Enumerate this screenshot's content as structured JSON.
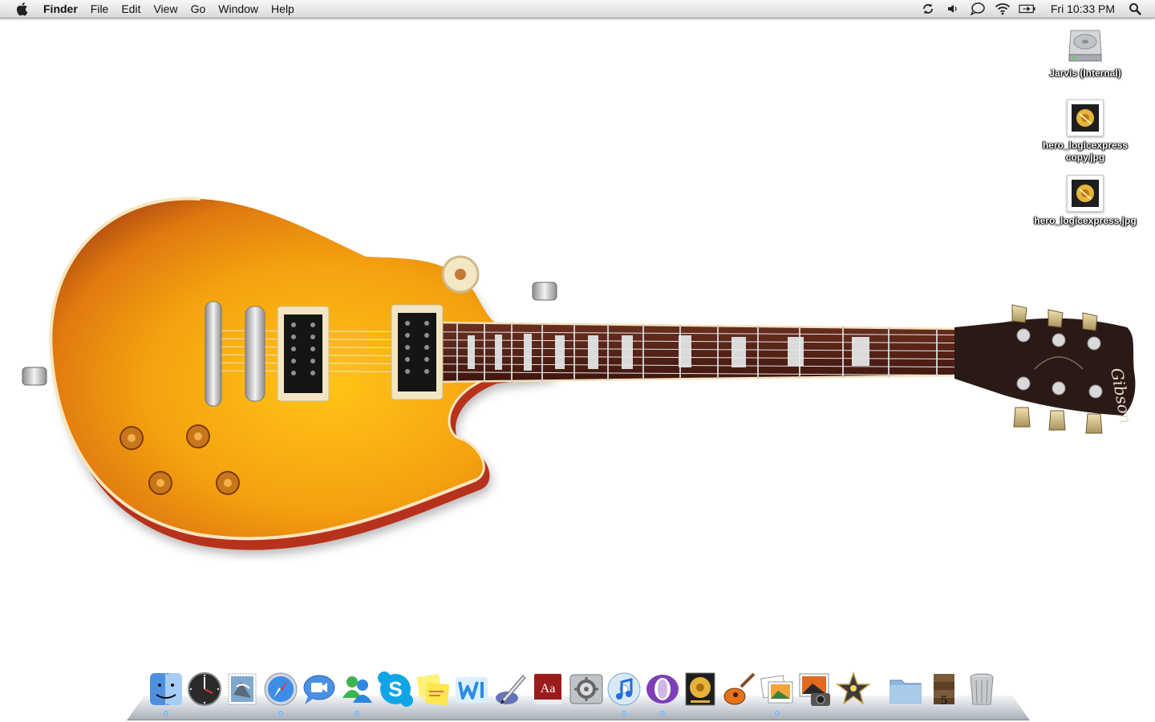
{
  "menubar": {
    "apple_icon": "apple-logo-icon",
    "app_name": "Finder",
    "menus": [
      "File",
      "Edit",
      "View",
      "Go",
      "Window",
      "Help"
    ],
    "status_icons": [
      "sync-icon",
      "volume-icon",
      "ichat-icon",
      "wifi-icon",
      "battery-icon"
    ],
    "clock": "Fri 10:33 PM",
    "spotlight_icon": "spotlight-search-icon"
  },
  "desktop": {
    "icons": [
      {
        "label": "Jarvis (Internal)",
        "icon": "hard-drive-icon"
      },
      {
        "label": "hero_logicexpress copy.jpg",
        "icon": "image-file-icon"
      },
      {
        "label": "hero_logicexpress.jpg",
        "icon": "image-file-icon"
      }
    ],
    "wallpaper": "electric-guitar-wallpaper"
  },
  "dock": {
    "apps": [
      {
        "name": "Finder",
        "icon": "finder-icon",
        "running": true
      },
      {
        "name": "Dashboard",
        "icon": "dashboard-icon",
        "running": false
      },
      {
        "name": "Mail",
        "icon": "mail-stamp-icon",
        "running": false
      },
      {
        "name": "Safari",
        "icon": "safari-compass-icon",
        "running": true
      },
      {
        "name": "iChat",
        "icon": "ichat-video-icon",
        "running": false
      },
      {
        "name": "Messenger",
        "icon": "messenger-people-icon",
        "running": true
      },
      {
        "name": "Skype",
        "icon": "skype-icon",
        "running": false
      },
      {
        "name": "Stickies",
        "icon": "stickies-icon",
        "running": false
      },
      {
        "name": "iWeb",
        "icon": "iweb-icon",
        "running": false
      },
      {
        "name": "Script Editor",
        "icon": "script-pen-icon",
        "running": false
      },
      {
        "name": "Dictionary",
        "icon": "dictionary-icon",
        "running": false
      },
      {
        "name": "System Preferences",
        "icon": "system-preferences-icon",
        "running": false
      },
      {
        "name": "iTunes",
        "icon": "itunes-icon",
        "running": true
      },
      {
        "name": "Opera",
        "icon": "opera-icon",
        "running": true
      },
      {
        "name": "Logic Express",
        "icon": "logic-express-icon",
        "running": false
      },
      {
        "name": "GarageBand",
        "icon": "garageband-guitar-icon",
        "running": false
      },
      {
        "name": "iPhoto",
        "icon": "iphoto-icon",
        "running": true
      },
      {
        "name": "Photo Booth",
        "icon": "photo-booth-icon",
        "running": false
      },
      {
        "name": "iMovie",
        "icon": "imovie-star-icon",
        "running": false
      }
    ],
    "stacks": [
      {
        "name": "Applications",
        "icon": "folder-stack-icon"
      },
      {
        "name": "Downloads",
        "icon": "downloads-stack-icon"
      },
      {
        "name": "Trash",
        "icon": "trash-icon"
      }
    ],
    "accent_color": "#58a8ff"
  }
}
